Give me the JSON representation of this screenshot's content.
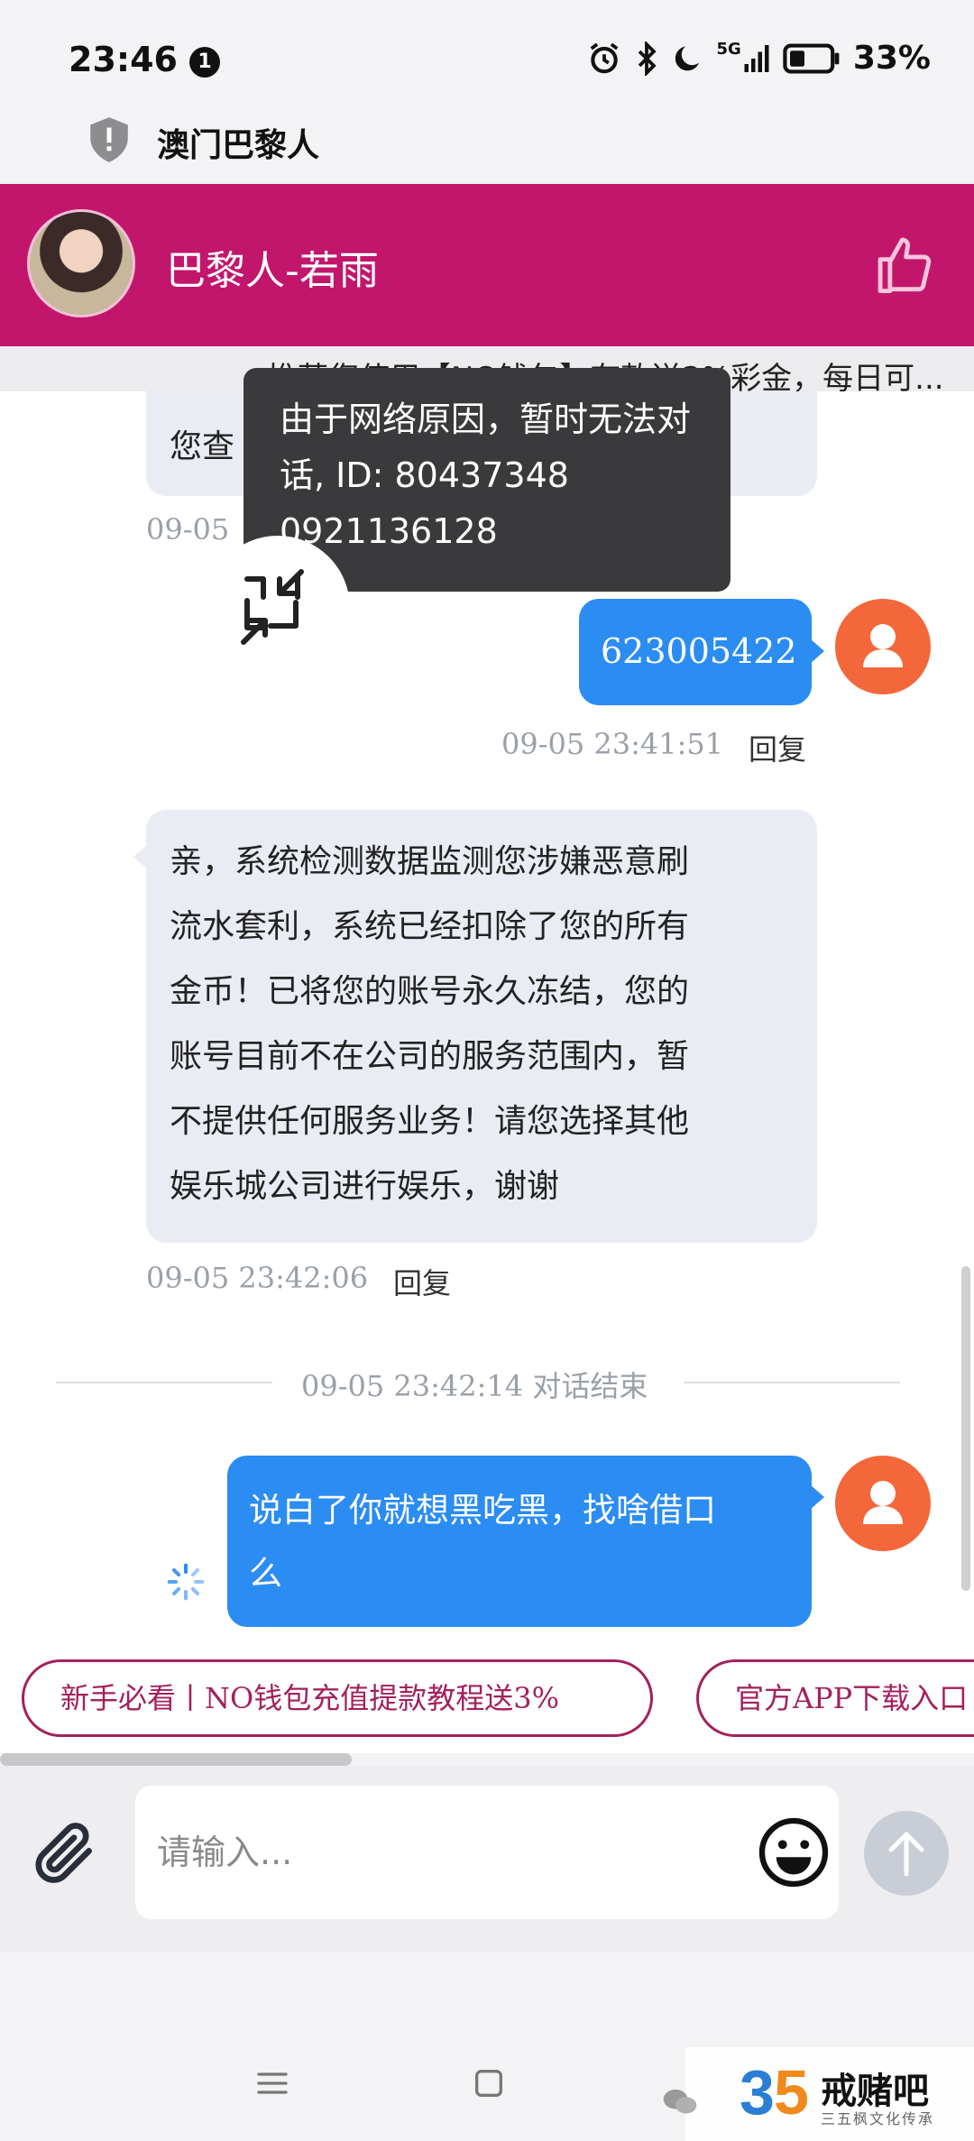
{
  "status": {
    "time": "23:46",
    "notification_count": "1",
    "network": "5G",
    "battery": "33%"
  },
  "site": {
    "title": "澳门巴黎人"
  },
  "header": {
    "agent_name": "巴黎人-若雨"
  },
  "marquee": {
    "text": "推荐您使用【NO钱包】存款送2%彩金，每日可..."
  },
  "tooltip": {
    "text": "由于网络原因，暂时无法对话, ID: 80437348 0921136128"
  },
  "messages": {
    "partial_text": "您查",
    "partial_time": "09-05",
    "user_msg_1": "623005422",
    "user_msg_1_time": "09-05 23:41:51",
    "reply_label": "回复",
    "agent_msg_lines": [
      "亲，系统检测数据监测您涉嫌恶意刷",
      "流水套利，系统已经扣除了您的所有",
      "金币！已将您的账号永久冻结，您的",
      "账号目前不在公司的服务范围内，暂",
      "不提供任何服务业务！请您选择其他",
      "娱乐城公司进行娱乐，谢谢"
    ],
    "agent_msg_time": "09-05 23:42:06",
    "divider": "09-05 23:42:14 对话结束",
    "user_msg_2_lines": [
      "说白了你就想黑吃黑，找啥借口",
      "么"
    ]
  },
  "quick_links": [
    "新手必看丨NO钱包充值提款教程送3%",
    "官方APP下载入口"
  ],
  "input": {
    "placeholder": "请输入..."
  },
  "watermark": {
    "text": "戒赌吧",
    "subtext": "三五枫文化传承"
  },
  "colors": {
    "header": "#c2166c",
    "user_bubble": "#2b8cf2",
    "agent_bubble": "#e9ecf3",
    "user_avatar": "#f4673a",
    "chip_border": "#a3205e"
  }
}
